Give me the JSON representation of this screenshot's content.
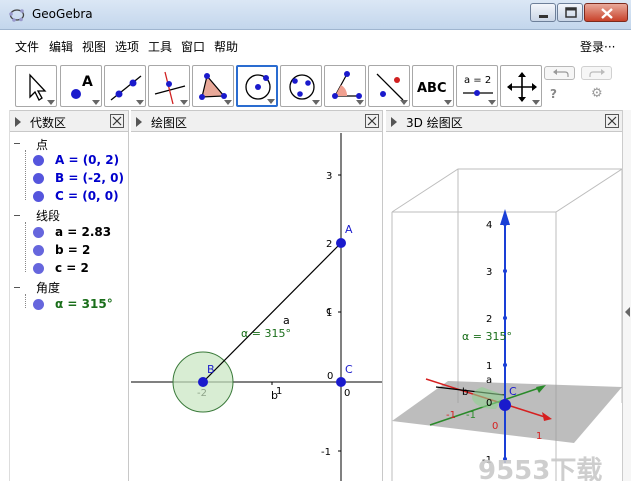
{
  "window": {
    "title": "GeoGebra"
  },
  "menu": {
    "items": [
      "文件",
      "编辑",
      "视图",
      "选项",
      "工具",
      "窗口",
      "帮助"
    ],
    "login": "登录···"
  },
  "toolbar": {
    "tools": [
      {
        "name": "move-tool",
        "label": ""
      },
      {
        "name": "point-tool",
        "label": "A"
      },
      {
        "name": "line-tool",
        "label": ""
      },
      {
        "name": "perpendicular-line-tool",
        "label": ""
      },
      {
        "name": "polygon-tool",
        "label": ""
      },
      {
        "name": "circle-tool",
        "label": ""
      },
      {
        "name": "circle-three-points-tool",
        "label": ""
      },
      {
        "name": "angle-tool",
        "label": ""
      },
      {
        "name": "reflect-tool",
        "label": ""
      },
      {
        "name": "text-tool",
        "label": "ABC"
      },
      {
        "name": "slider-tool",
        "label": "a = 2"
      },
      {
        "name": "move-view-tool",
        "label": ""
      }
    ],
    "help": "?",
    "settings": "⚙"
  },
  "algebra": {
    "title": "代数区",
    "categories": [
      {
        "label": "点",
        "items": [
          {
            "text": "A = (0, 2)",
            "color": "#0000cc"
          },
          {
            "text": "B = (-2, 0)",
            "color": "#0000cc"
          },
          {
            "text": "C = (0, 0)",
            "color": "#0000cc"
          }
        ]
      },
      {
        "label": "线段",
        "items": [
          {
            "text": "a = 2.83",
            "color": "#000000"
          },
          {
            "text": "b = 2",
            "color": "#000000"
          },
          {
            "text": "c = 2",
            "color": "#000000"
          }
        ]
      },
      {
        "label": "角度",
        "items": [
          {
            "text": "α = 315°",
            "color": "#1a6e1a"
          }
        ]
      }
    ]
  },
  "graphics": {
    "title": "绘图区",
    "y_ticks": [
      "3",
      "2",
      "1",
      "0",
      "-1"
    ],
    "x_ticks": [
      "-2",
      "1",
      "0"
    ],
    "labels": {
      "A": "A",
      "B": "B",
      "C": "C",
      "a": "a",
      "b": "b",
      "c": "c",
      "angle": "α = 315°"
    }
  },
  "graphics3d": {
    "title": "3D 绘图区",
    "z_ticks": [
      "4",
      "3",
      "2",
      "1",
      "0",
      "-1"
    ],
    "labels": {
      "angle": "α = 315°",
      "C": "C",
      "b": "b",
      "a": "a",
      "neg1a": "-1",
      "neg1b": "-1",
      "zero": "0",
      "one": "1"
    }
  },
  "watermark": "9553下载",
  "colors": {
    "point": "#1a1acc",
    "angle_fill": "#c8e6c0",
    "angle_stroke": "#3a7a3a",
    "z_axis": "#1a3fd6",
    "x_axis": "#d62020",
    "y_axis": "#2a8a2a"
  }
}
